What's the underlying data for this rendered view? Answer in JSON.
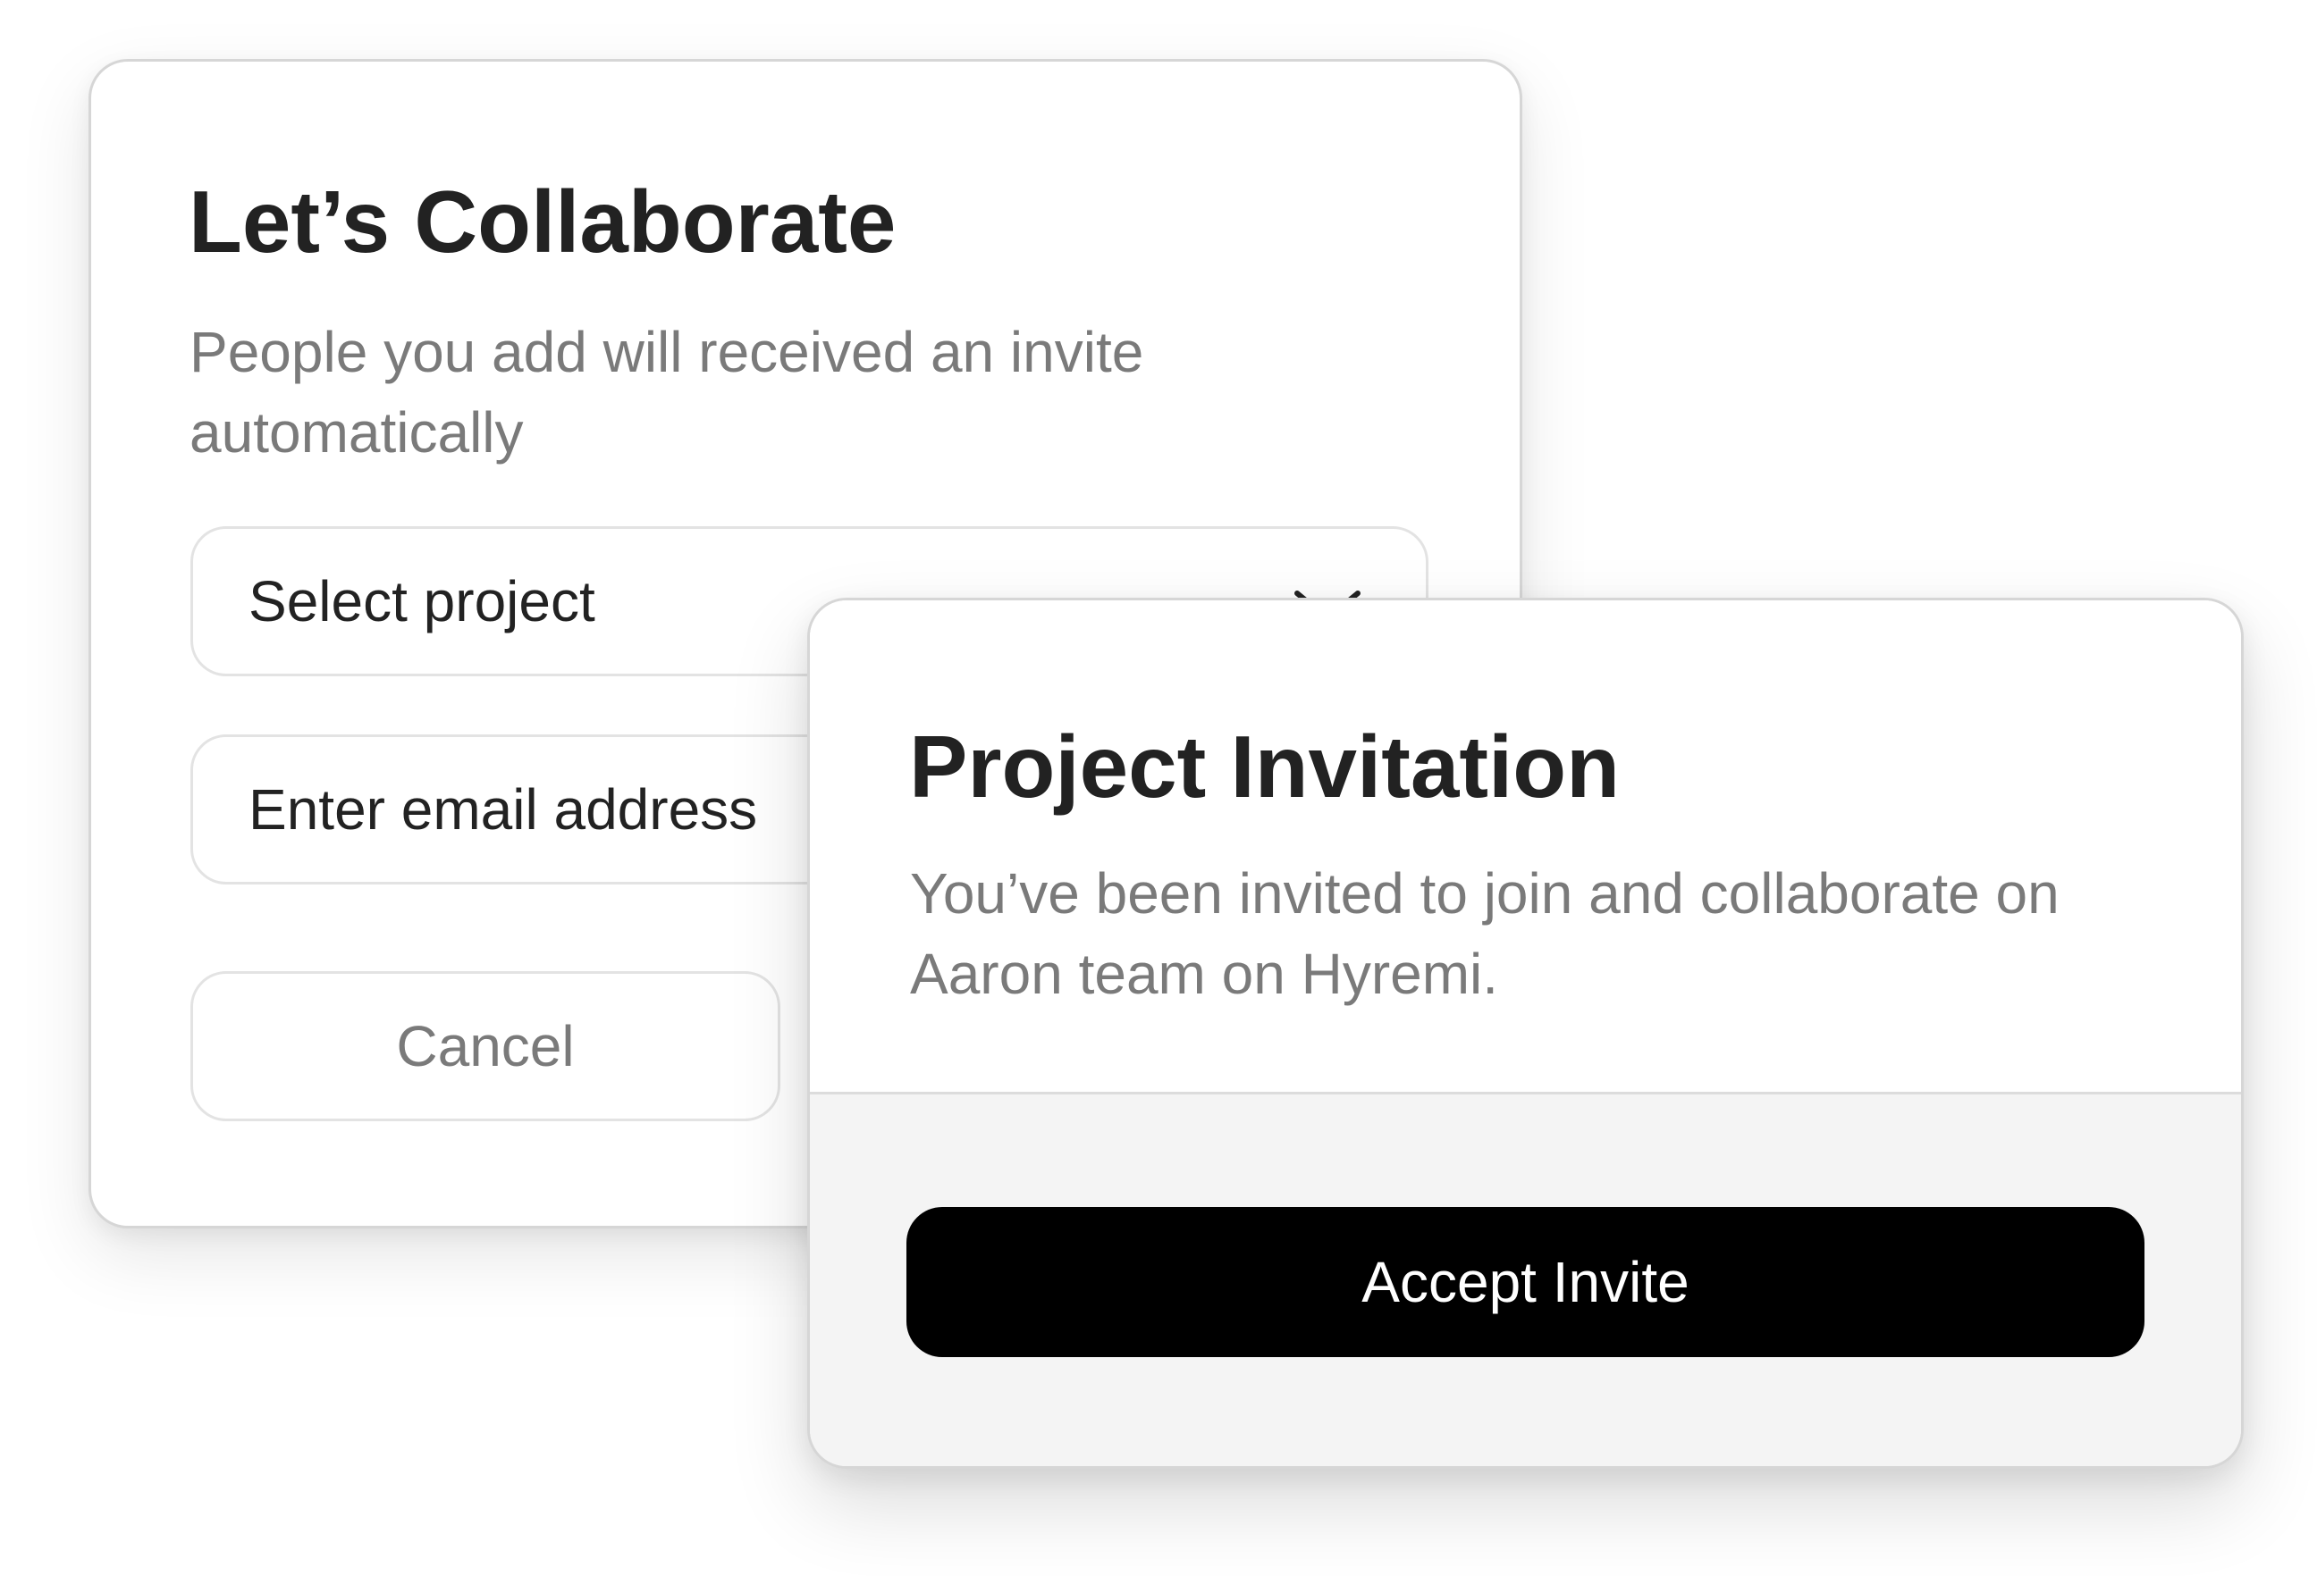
{
  "collaborate_card": {
    "title": "Let’s Collaborate",
    "subtitle": "People you add will received an invite automatically",
    "project_select": {
      "value": "Select project",
      "icon": "chevron-down-icon"
    },
    "email_input": {
      "placeholder": "Enter email address"
    },
    "cancel_label": "Cancel"
  },
  "invitation_card": {
    "title": "Project Invitation",
    "message": "You’ve been invited to join and collaborate on Aaron team on Hyremi.",
    "accept_label": "Accept Invite"
  },
  "colors": {
    "primary_button": "#000000",
    "primary_button_text": "#ffffff",
    "heading_text": "#222222",
    "muted_text": "#7a7a7a",
    "card_footer_bg": "#f4f4f4",
    "border": "#d6d6d6"
  }
}
